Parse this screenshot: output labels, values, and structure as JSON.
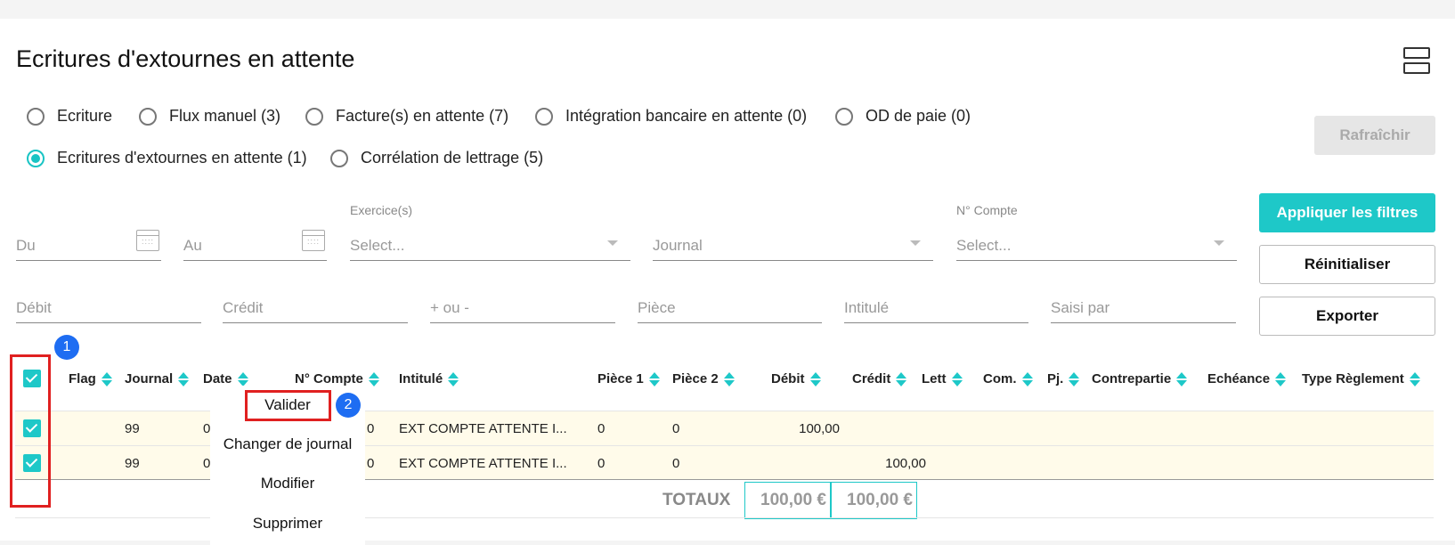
{
  "page": {
    "title": "Ecritures d'extournes en attente"
  },
  "tabs": [
    {
      "label": "Ecriture",
      "checked": false
    },
    {
      "label": "Flux manuel (3)",
      "checked": false
    },
    {
      "label": "Facture(s) en attente (7)",
      "checked": false
    },
    {
      "label": "Intégration bancaire en attente (0)",
      "checked": false
    },
    {
      "label": "OD de paie (0)",
      "checked": false
    },
    {
      "label": "Ecritures d'extournes en attente (1)",
      "checked": true
    },
    {
      "label": "Corrélation de lettrage (5)",
      "checked": false
    }
  ],
  "buttons": {
    "refresh": "Rafraîchir",
    "apply": "Appliquer les filtres",
    "reset": "Réinitialiser",
    "export": "Exporter"
  },
  "filters": {
    "du": "Du",
    "au": "Au",
    "exercice_label": "Exercice(s)",
    "exercice": "Select...",
    "journal": "Journal",
    "compte_label": "N° Compte",
    "compte": "Select...",
    "debit": "Débit",
    "credit": "Crédit",
    "plus_minus": "+ ou -",
    "piece": "Pièce",
    "intitule": "Intitulé",
    "saisi_par": "Saisi par"
  },
  "table": {
    "columns": [
      "Flag",
      "Journal",
      "Date",
      "N° Compte",
      "Intitulé",
      "Pièce 1",
      "Pièce 2",
      "Débit",
      "Crédit",
      "Lett",
      "Com.",
      "Pj.",
      "Contrepartie",
      "Echéance",
      "Type Règlement"
    ],
    "rows": [
      {
        "journal": "99",
        "date": "0",
        "compte": "0",
        "intitule": "EXT COMPTE ATTENTE I...",
        "piece1": "0",
        "piece2": "0",
        "debit": "100,00",
        "credit": ""
      },
      {
        "journal": "99",
        "date": "0",
        "compte": "0",
        "intitule": "EXT COMPTE ATTENTE I...",
        "piece1": "0",
        "piece2": "0",
        "debit": "",
        "credit": "100,00"
      }
    ],
    "totals_label": "TOTAUX",
    "total_debit": "100,00 €",
    "total_credit": "100,00 €"
  },
  "context_menu": [
    "Valider",
    "Changer de journal",
    "Modifier",
    "Supprimer"
  ],
  "badges": [
    "1",
    "2"
  ],
  "colors": {
    "accent": "#1ec8c8",
    "highlight": "#e02020",
    "badge": "#1e6df2",
    "row_bg": "#fffbea"
  }
}
